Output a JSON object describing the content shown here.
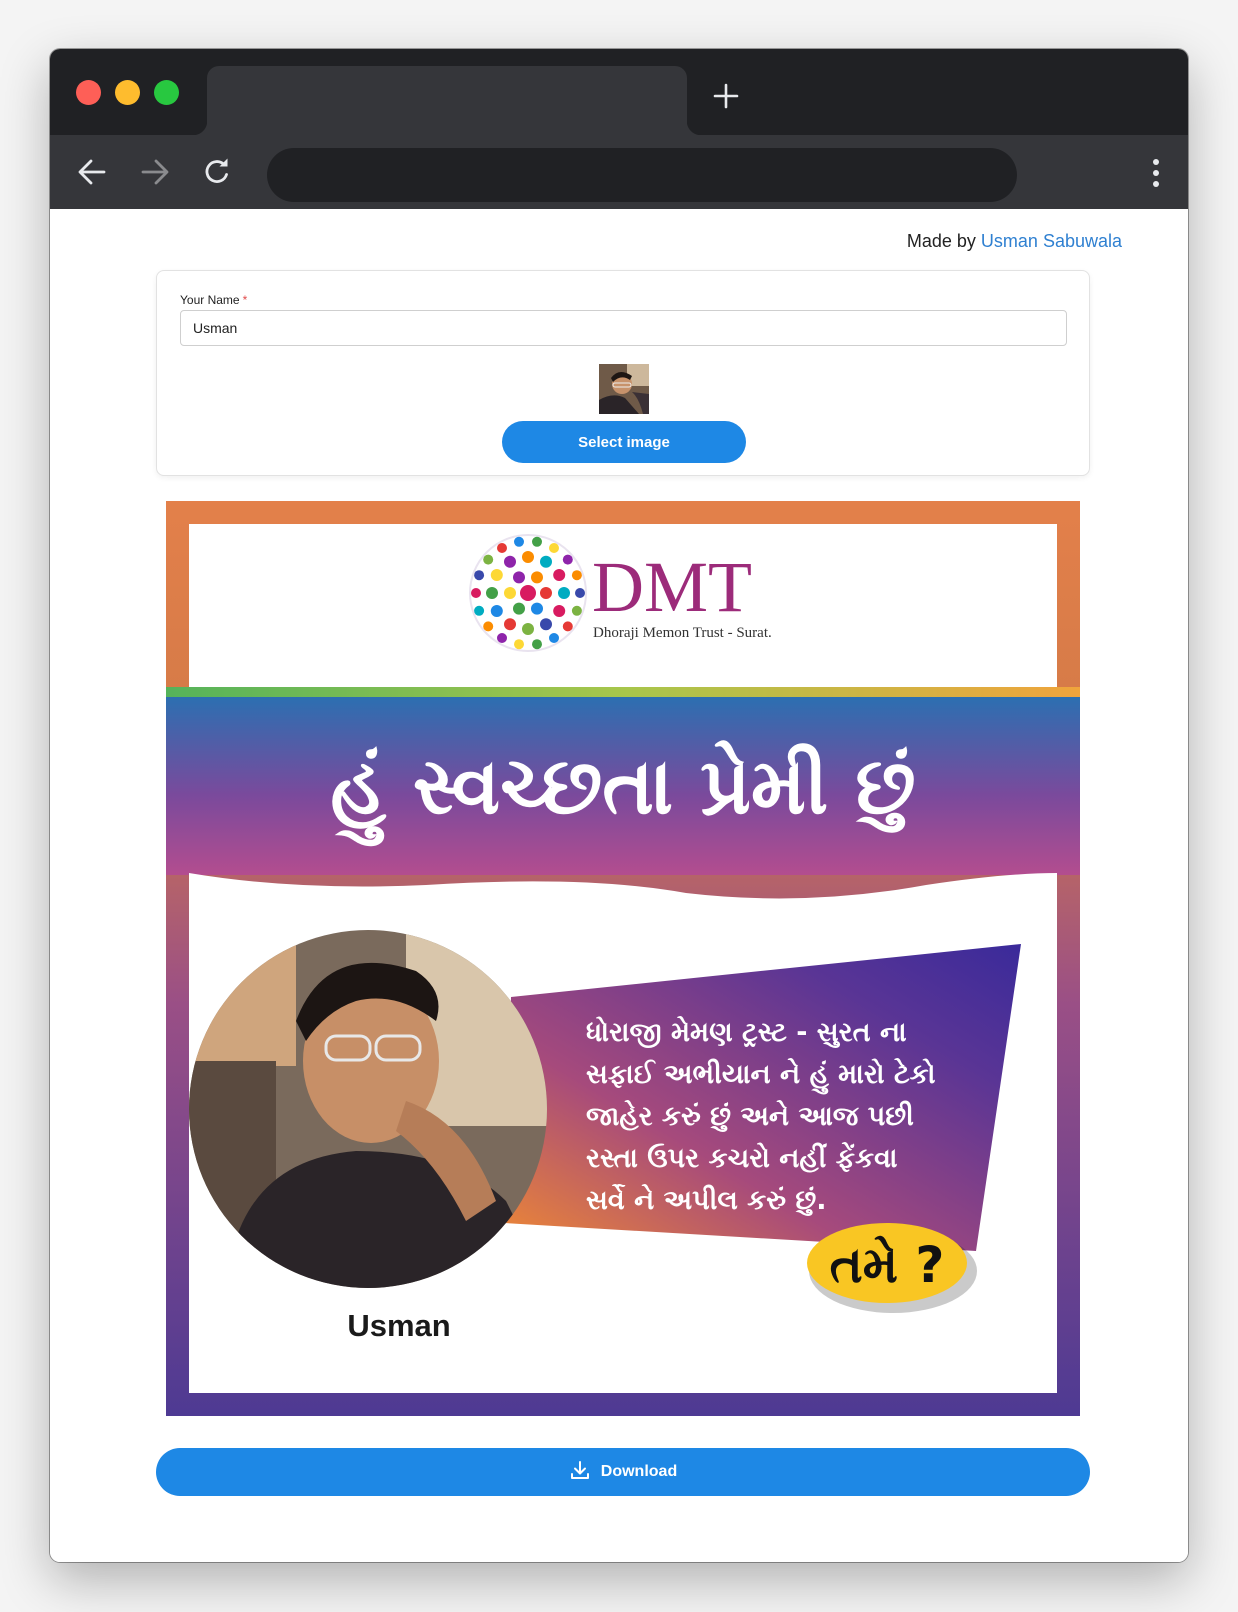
{
  "attribution": {
    "prefix": "Made by",
    "author_link": "Usman Sabuwala"
  },
  "form": {
    "name_label": "Your Name",
    "required_marker": "*",
    "name_value": "Usman",
    "select_image_label": "Select image"
  },
  "poster": {
    "logo_text": "DMT",
    "logo_subtitle": "Dhoraji Memon Trust - Surat.",
    "headline": "હું સ્વચ્છતા પ્રેમી છું",
    "pledge_lines": [
      "ધોરાજી મેમણ ટ્રસ્ટ - સુરત ના",
      "સફાઈ અભીયાન ને હું મારો ટેકો",
      "જાહેર કરું છું અને આજ પછી",
      "રસ્તા ઉપર કચરો નહીં ફેંકવા",
      "સર્વે ને અપીલ કરું છું."
    ],
    "callout": "તમે ?",
    "person_name": "Usman"
  },
  "download_label": "Download",
  "colors": {
    "accent": "#1e88e5",
    "link": "#2f80d1",
    "dmt_magenta": "#9c2b7a",
    "callout_yellow": "#f9c623"
  },
  "icons": [
    "back-arrow-icon",
    "forward-arrow-icon",
    "reload-icon",
    "new-tab-plus-icon",
    "kebab-menu-icon",
    "download-icon"
  ]
}
